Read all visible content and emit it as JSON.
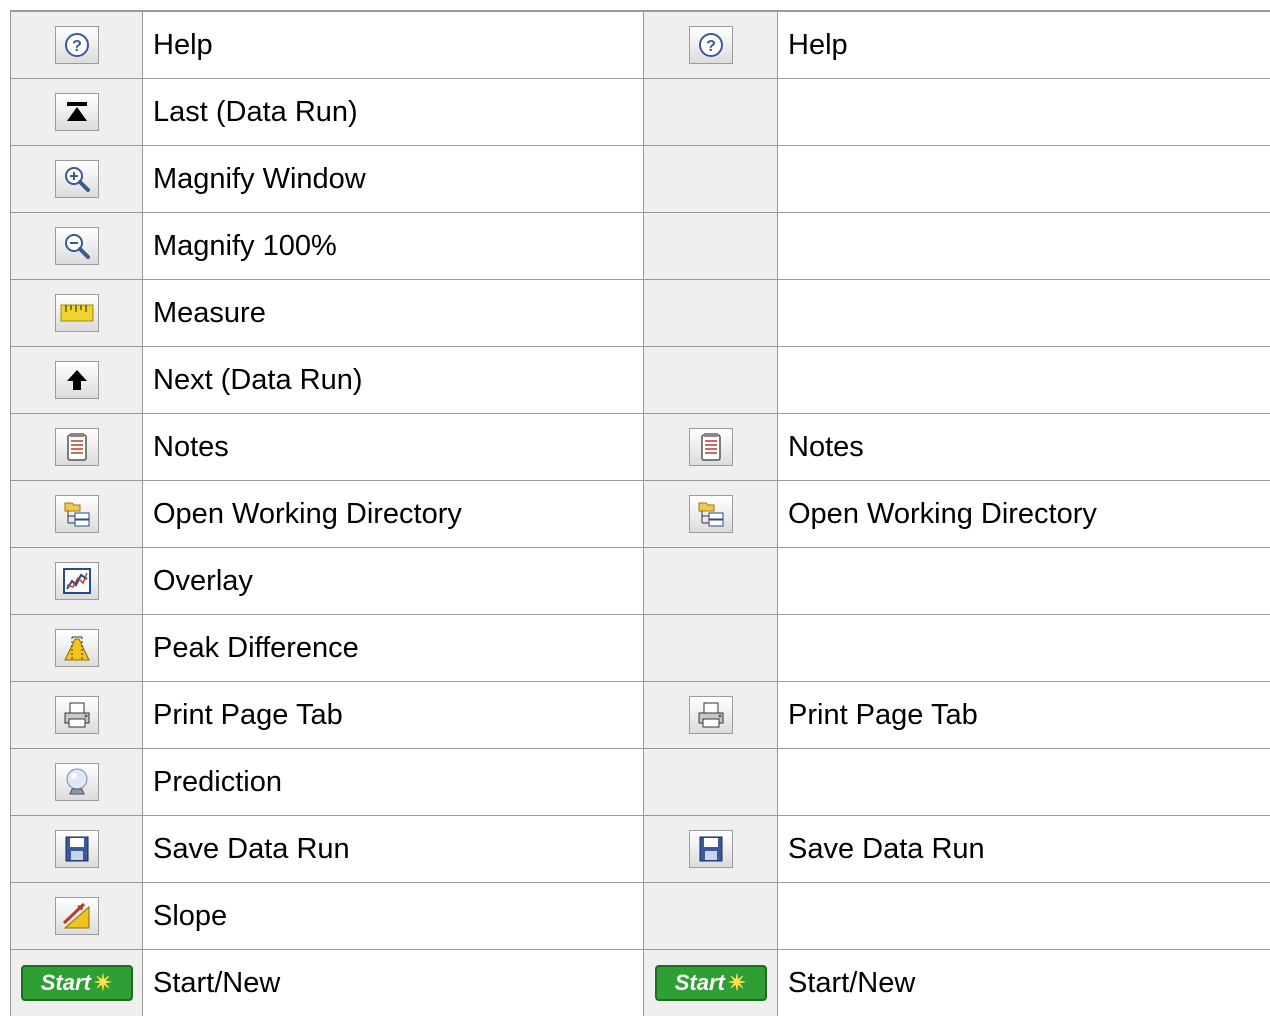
{
  "rows": [
    {
      "left": {
        "icon": "help-icon",
        "label": "Help"
      },
      "right": {
        "icon": "help-icon",
        "label": "Help"
      }
    },
    {
      "left": {
        "icon": "last-icon",
        "label": "Last (Data Run)"
      },
      "right": null
    },
    {
      "left": {
        "icon": "magnify-window-icon",
        "label": "Magnify Window"
      },
      "right": null
    },
    {
      "left": {
        "icon": "magnify-100-icon",
        "label": "Magnify 100%"
      },
      "right": null
    },
    {
      "left": {
        "icon": "measure-icon",
        "label": "Measure"
      },
      "right": null
    },
    {
      "left": {
        "icon": "next-icon",
        "label": "Next (Data Run)"
      },
      "right": null
    },
    {
      "left": {
        "icon": "notes-icon",
        "label": "Notes"
      },
      "right": {
        "icon": "notes-icon",
        "label": "Notes"
      }
    },
    {
      "left": {
        "icon": "open-directory-icon",
        "label": "Open Working Directory"
      },
      "right": {
        "icon": "open-directory-icon",
        "label": "Open Working Directory"
      }
    },
    {
      "left": {
        "icon": "overlay-icon",
        "label": "Overlay"
      },
      "right": null
    },
    {
      "left": {
        "icon": "peak-difference-icon",
        "label": "Peak Difference"
      },
      "right": null
    },
    {
      "left": {
        "icon": "print-icon",
        "label": "Print Page Tab"
      },
      "right": {
        "icon": "print-icon",
        "label": "Print Page Tab"
      }
    },
    {
      "left": {
        "icon": "prediction-icon",
        "label": "Prediction"
      },
      "right": null
    },
    {
      "left": {
        "icon": "save-icon",
        "label": "Save Data Run"
      },
      "right": {
        "icon": "save-icon",
        "label": "Save Data Run"
      }
    },
    {
      "left": {
        "icon": "slope-icon",
        "label": "Slope"
      },
      "right": null
    },
    {
      "left": {
        "icon": "start-icon",
        "label": "Start/New",
        "button_text": "Start"
      },
      "right": {
        "icon": "start-icon",
        "label": "Start/New",
        "button_text": "Start"
      }
    }
  ]
}
